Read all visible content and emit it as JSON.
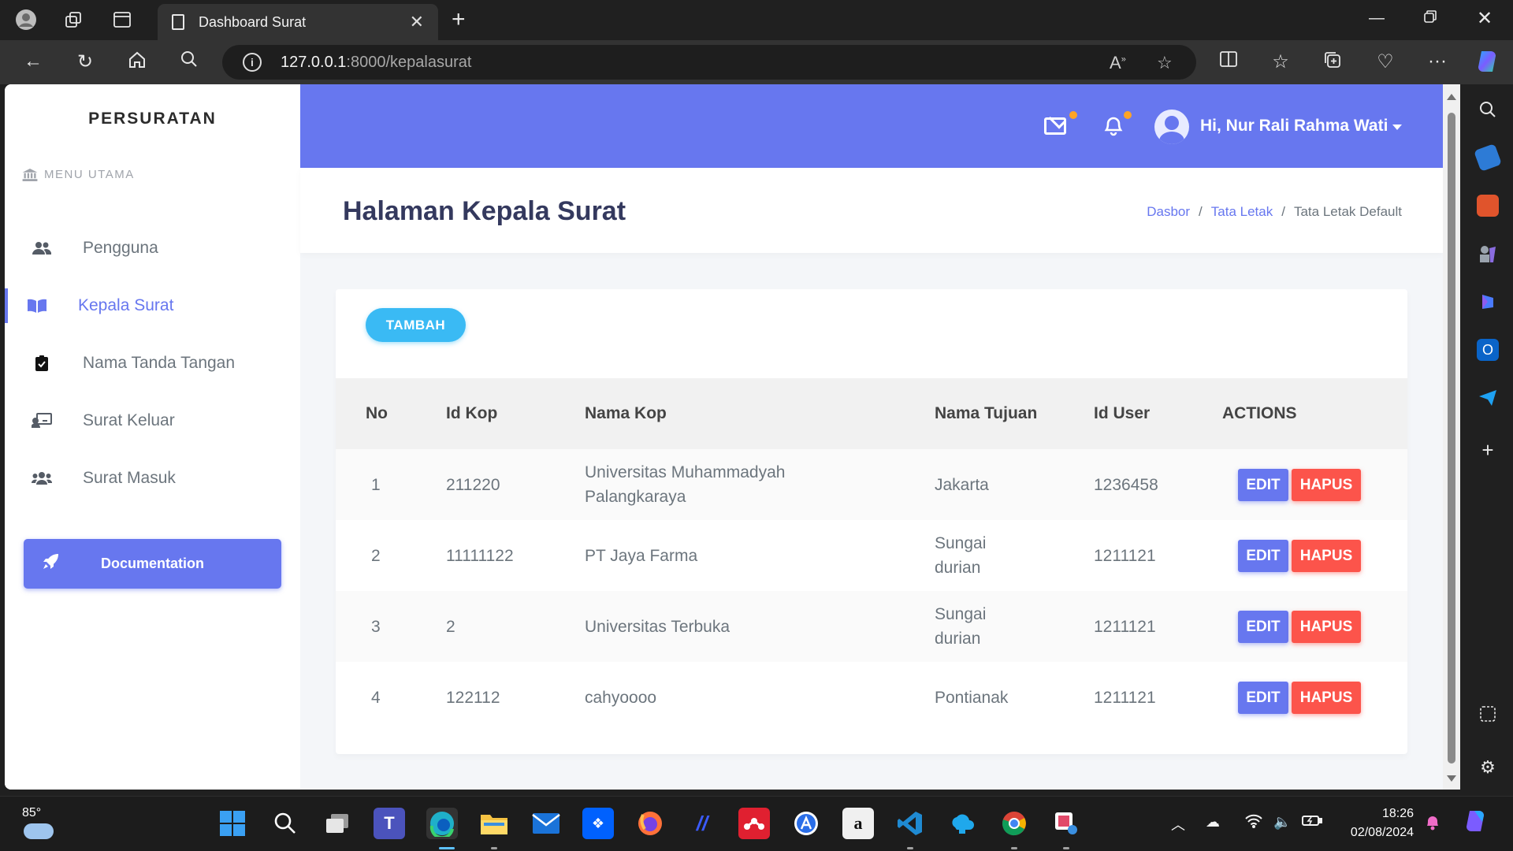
{
  "browser": {
    "tab_title": "Dashboard Surat",
    "url_host": "127.0.0.1",
    "url_rest": ":8000/kepalasurat"
  },
  "sidebar": {
    "brand": "PERSURATAN",
    "menu_heading": "MENU UTAMA",
    "items": [
      {
        "label": "Pengguna",
        "icon": "users-icon",
        "active": false
      },
      {
        "label": "Kepala Surat",
        "icon": "book-icon",
        "active": true
      },
      {
        "label": "Nama Tanda Tangan",
        "icon": "clipboard-check-icon",
        "active": false
      },
      {
        "label": "Surat Keluar",
        "icon": "chalkboard-teacher-icon",
        "active": false
      },
      {
        "label": "Surat Masuk",
        "icon": "user-group-icon",
        "active": false
      }
    ],
    "documentation_label": "Documentation"
  },
  "navbar": {
    "user_greeting": "Hi, Nur Rali Rahma Wati",
    "accent_color": "#6777ef",
    "notification_dot_color": "#ffa426"
  },
  "header": {
    "title": "Halaman Kepala Surat",
    "breadcrumb": [
      "Dasbor",
      "Tata Letak",
      "Tata Letak Default"
    ]
  },
  "card": {
    "add_button": "TAMBAH",
    "columns": [
      "No",
      "Id Kop",
      "Nama Kop",
      "Nama Tujuan",
      "Id User",
      "ACTIONS"
    ],
    "rows": [
      {
        "no": "1",
        "id_kop": "211220",
        "nama_kop": "Universitas Muhammadyah Palangkaraya",
        "nama_tujuan": "Jakarta",
        "id_user": "1236458"
      },
      {
        "no": "2",
        "id_kop": "11111122",
        "nama_kop": "PT Jaya Farma",
        "nama_tujuan": "Sungai durian",
        "id_user": "1211121"
      },
      {
        "no": "3",
        "id_kop": "2",
        "nama_kop": "Universitas Terbuka",
        "nama_tujuan": "Sungai durian",
        "id_user": "1211121"
      },
      {
        "no": "4",
        "id_kop": "122112",
        "nama_kop": "cahyoooo",
        "nama_tujuan": "Pontianak",
        "id_user": "1211121"
      }
    ],
    "edit_label": "EDIT",
    "delete_label": "HAPUS"
  },
  "taskbar": {
    "temperature": "85°",
    "time": "18:26",
    "date": "02/08/2024"
  }
}
